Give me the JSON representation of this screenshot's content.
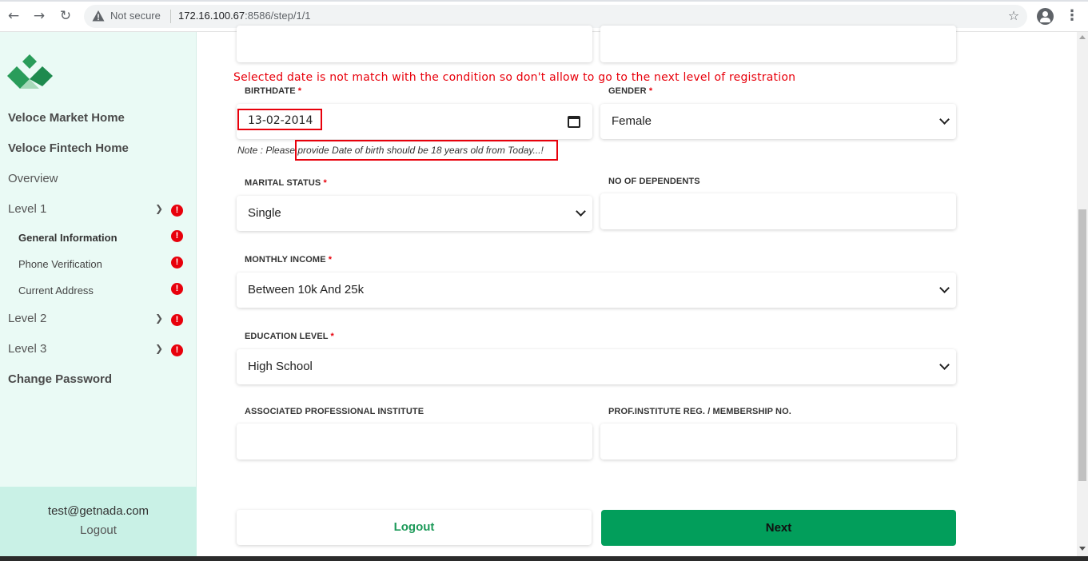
{
  "browser": {
    "security_label": "Not secure",
    "url_host": "172.16.100.67",
    "url_rest": ":8586/step/1/1"
  },
  "sidebar": {
    "items": [
      {
        "label": "Veloce Market Home"
      },
      {
        "label": "Veloce Fintech Home"
      },
      {
        "label": "Overview"
      },
      {
        "label": "Level 1"
      },
      {
        "label": "General Information"
      },
      {
        "label": "Phone Verification"
      },
      {
        "label": "Current Address"
      },
      {
        "label": "Level 2"
      },
      {
        "label": "Level 3"
      },
      {
        "label": "Change Password"
      }
    ],
    "alert_glyph": "!",
    "user_email": "test@getnada.com",
    "logout_label": "Logout"
  },
  "form": {
    "error_message": "Selected date is not match with the condition so don't allow to go to the next level of registration",
    "birthdate": {
      "label": "BIRTHDATE",
      "value": "13-02-2014"
    },
    "gender": {
      "label": "GENDER",
      "value": "Female"
    },
    "note_prefix": "Note : Please ",
    "note_text": "provide Date of birth should be 18 years old from Today...!",
    "marital_status": {
      "label": "MARITAL STATUS",
      "value": "Single"
    },
    "dependents": {
      "label": "NO OF DEPENDENTS",
      "value": ""
    },
    "monthly_income": {
      "label": "MONTHLY INCOME",
      "value": "Between 10k And 25k"
    },
    "education_level": {
      "label": "EDUCATION LEVEL",
      "value": "High School"
    },
    "professional_institute": {
      "label": "ASSOCIATED PROFESSIONAL INSTITUTE",
      "value": ""
    },
    "membership_no": {
      "label": "PROF.INSTITUTE REG. / MEMBERSHIP NO.",
      "value": ""
    },
    "required_mark": "*",
    "logout_button": "Logout",
    "next_button": "Next"
  },
  "colors": {
    "accent_green": "#029e5b",
    "error_red": "#e8000b",
    "sidebar_bg": "#eafaf5"
  }
}
